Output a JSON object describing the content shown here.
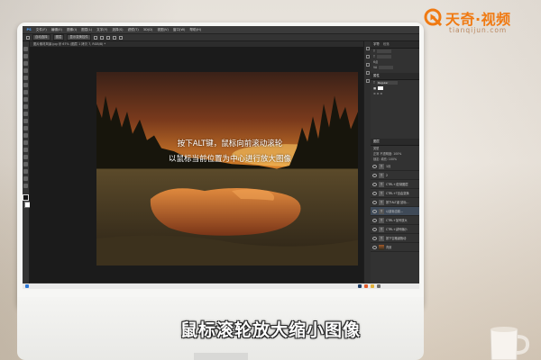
{
  "app": {
    "menu_items": [
      "PS",
      "文件(F)",
      "编辑(E)",
      "图像(I)",
      "图层(L)",
      "文字(Y)",
      "选择(S)",
      "滤镜(T)",
      "3D(D)",
      "视图(V)",
      "窗口(W)",
      "帮助(H)"
    ],
    "options_bar": [
      "显示变换控件",
      "自动选择",
      "图层"
    ],
    "document_tab": "图片素材风景.jpg @ 67% (图层 1 拷贝 7, RGB/8) *",
    "zoom_status": "67%",
    "status_text": "文档:1.58M/12.3M"
  },
  "panels": {
    "character_tab": "字符",
    "paragraph_tab": "段落",
    "properties_tab": "属性",
    "layers_tab": "图层",
    "kind_filter": "类型",
    "blend_mode": "正常",
    "opacity_label": "不透明度: 100%",
    "lock_label": "锁定:",
    "fill_label": "填充: 100%",
    "font_size_label": "6点",
    "font_field": "Regular",
    "layers": [
      {
        "label": "1月",
        "kind": "text"
      },
      {
        "label": "2",
        "kind": "text"
      },
      {
        "label": "CTRL+J复制图层",
        "kind": "text"
      },
      {
        "label": "CTRL+T自由变换",
        "kind": "text"
      },
      {
        "label": "按下ALT键 鼠标...",
        "kind": "text"
      },
      {
        "label": "以鼠标当前...",
        "kind": "text",
        "selected": true
      },
      {
        "label": "CTRL+加号放大",
        "kind": "text"
      },
      {
        "label": "CTRL+减号缩小",
        "kind": "text"
      },
      {
        "label": "按下空格键拖动",
        "kind": "text"
      },
      {
        "label": "背景",
        "kind": "image"
      }
    ]
  },
  "canvas_caption": {
    "line1": "按下ALT键，鼠标向前滚动滚轮",
    "line2": "以鼠标当前位置为中心进行放大图像"
  },
  "subtitle": "鼠标滚轮放大缩小图像",
  "logo": {
    "brand": "天奇·视频",
    "url": "tianqijun.com"
  },
  "colors": {
    "brand_orange": "#f07a12",
    "ps_panel": "#323232",
    "ps_canvas": "#1b1b1b",
    "selected_layer": "#3f4a58"
  }
}
